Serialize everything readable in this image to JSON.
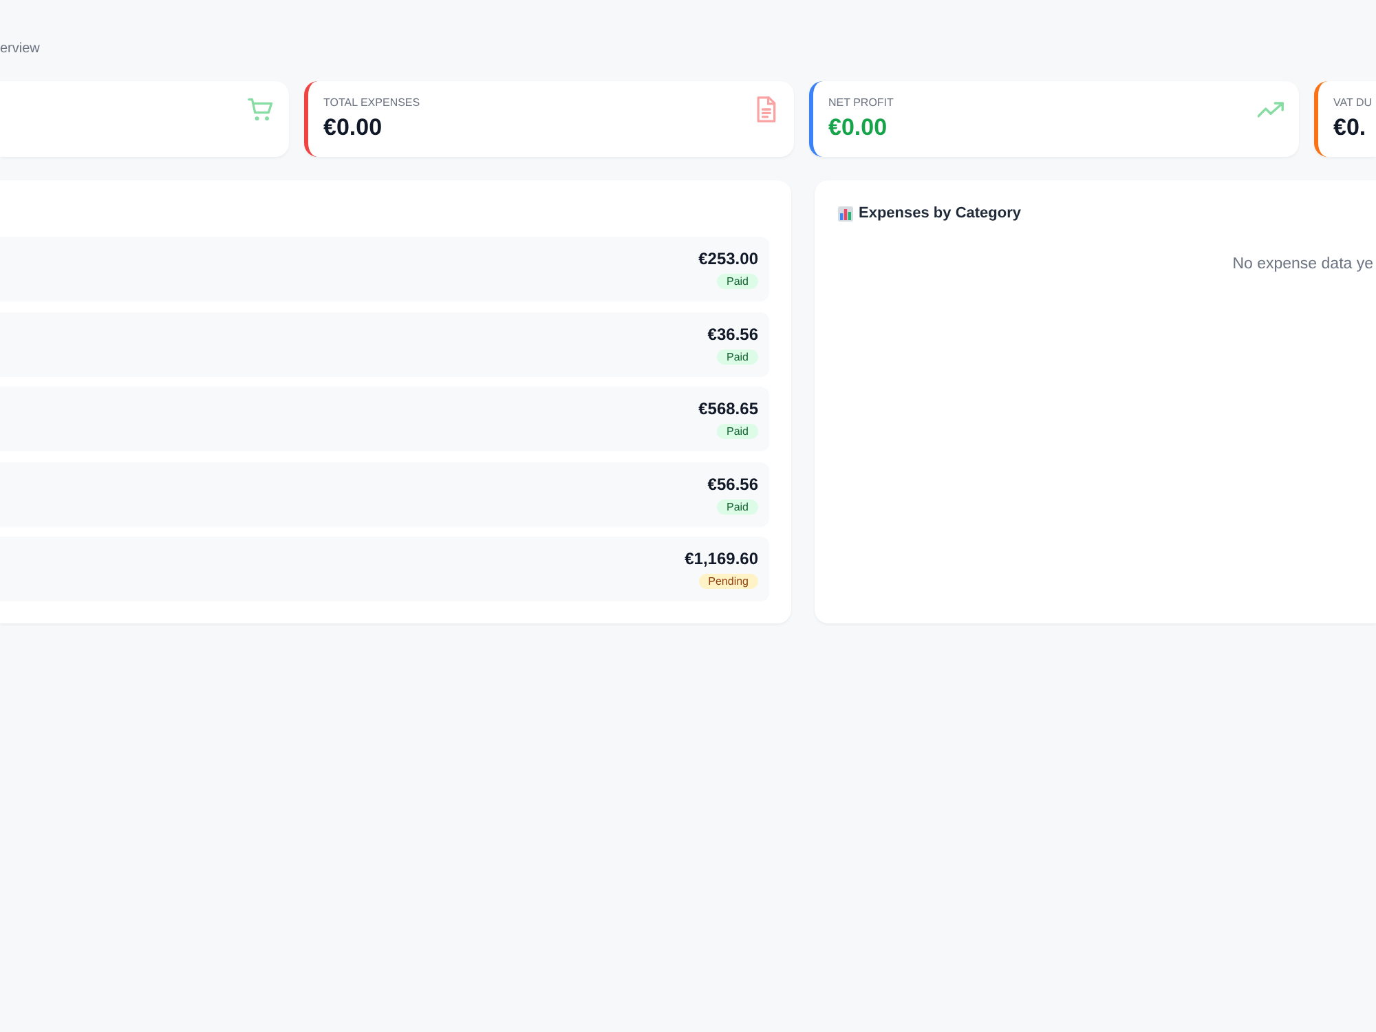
{
  "header": {
    "subtitle": "erview"
  },
  "stat_cards": [
    {
      "kind": "cart"
    },
    {
      "label": "TOTAL EXPENSES",
      "value": "€0.00",
      "color": "#ef4444",
      "kind": "document",
      "positive": false
    },
    {
      "label": "NET PROFIT",
      "value": "€0.00",
      "color": "#3b82f6",
      "kind": "trend",
      "positive": true
    },
    {
      "label": "VAT DU",
      "value": "€0.",
      "color": "#f97316",
      "positive": false
    }
  ],
  "recent_list": {
    "items": [
      {
        "amount": "€253.00",
        "status": "Paid",
        "kind": "paid"
      },
      {
        "amount": "€36.56",
        "status": "Paid",
        "kind": "paid"
      },
      {
        "amount": "€568.65",
        "status": "Paid",
        "kind": "paid"
      },
      {
        "amount": "€56.56",
        "status": "Paid",
        "kind": "paid"
      },
      {
        "amount": "€1,169.60",
        "status": "Pending",
        "kind": "pending"
      }
    ]
  },
  "expenses_chart": {
    "title": "Expenses by Category",
    "empty_text": "No expense data ye"
  }
}
